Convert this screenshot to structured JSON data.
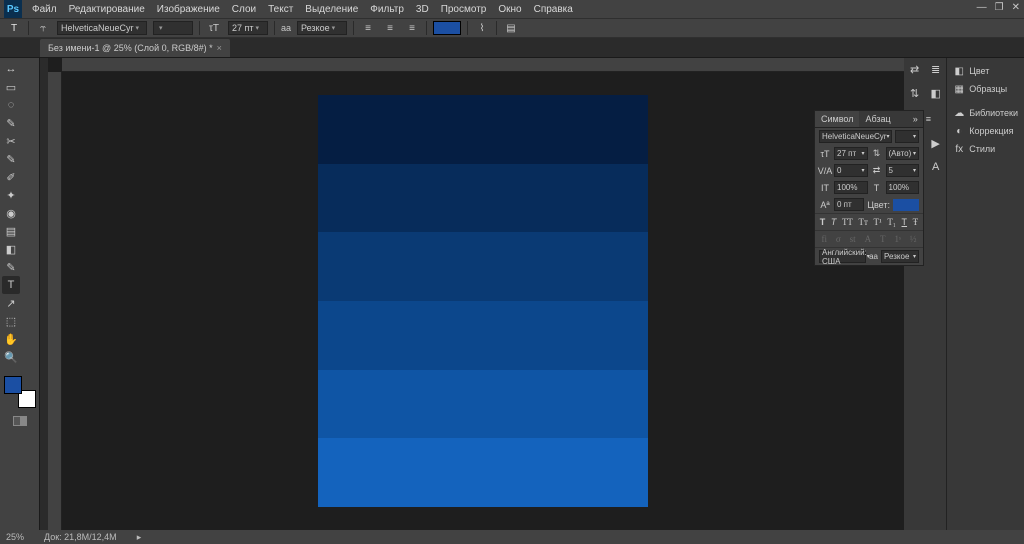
{
  "app": {
    "logo": "Ps"
  },
  "menu": [
    "Файл",
    "Редактирование",
    "Изображение",
    "Слои",
    "Текст",
    "Выделение",
    "Фильтр",
    "3D",
    "Просмотр",
    "Окно",
    "Справка"
  ],
  "doc_tab": "Без имени-1 @ 25% (Слой 0, RGB/8#) *",
  "options": {
    "tool_letter": "T",
    "font": "HelveticaNeueCyr",
    "font_style": "",
    "size": "27 пт",
    "aa": "Резкое",
    "swatch_color": "#1b4fa3"
  },
  "tool_icons": [
    "↔",
    "▭",
    "◌",
    "✎",
    "✂",
    "✎",
    "✐",
    "✦",
    "◉",
    "▤",
    "◧",
    "✎",
    "T",
    "↗",
    "⬚",
    "✋",
    "🔍"
  ],
  "right_mini": [
    "⇄",
    "⇅",
    "≣",
    "◧",
    "▶",
    "A"
  ],
  "right_panels": [
    {
      "icon": "◧",
      "label": "Цвет"
    },
    {
      "icon": "▦",
      "label": "Образцы"
    },
    {
      "icon": "☁",
      "label": "Библиотеки"
    },
    {
      "icon": "◐",
      "label": "Коррекция"
    },
    {
      "icon": "fx",
      "label": "Стили"
    }
  ],
  "char_panel": {
    "tab_character": "Символ",
    "tab_paragraph": "Абзац",
    "font": "HelveticaNeueCyr",
    "size": "27 пт",
    "leading": "(Авто)",
    "kerning": "0",
    "tracking": "5",
    "vscale": "100%",
    "hscale": "100%",
    "baseline": "0 пт",
    "color_label": "Цвет:",
    "language": "Английский: США",
    "aa": "Резкое"
  },
  "status": {
    "zoom": "25%",
    "doc_info": "Док: 21,8M/12,4M"
  }
}
